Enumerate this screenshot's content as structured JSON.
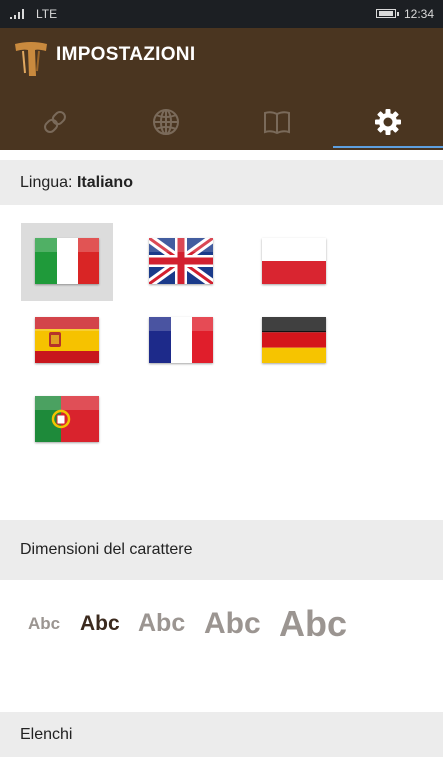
{
  "status": {
    "network": "LTE",
    "time": "12:34"
  },
  "header": {
    "title": "IMPOSTAZIONI",
    "logo_icon": "tau-cross-icon"
  },
  "tabs": [
    {
      "name": "link",
      "icon": "link-icon",
      "active": false
    },
    {
      "name": "web",
      "icon": "globe-icon",
      "active": false
    },
    {
      "name": "book",
      "icon": "book-icon",
      "active": false
    },
    {
      "name": "settings",
      "icon": "gear-icon",
      "active": true
    }
  ],
  "language": {
    "label": "Lingua:",
    "current": "Italiano",
    "flags": [
      {
        "name": "italy",
        "selected": true
      },
      {
        "name": "united-kingdom",
        "selected": false
      },
      {
        "name": "poland",
        "selected": false
      },
      {
        "name": "spain",
        "selected": false
      },
      {
        "name": "france",
        "selected": false
      },
      {
        "name": "germany",
        "selected": false
      },
      {
        "name": "portugal",
        "selected": false
      }
    ]
  },
  "font_size": {
    "label": "Dimensioni del carattere",
    "samples": [
      "Abc",
      "Abc",
      "Abc",
      "Abc",
      "Abc"
    ],
    "selected_index": 1
  },
  "next_section": {
    "label": "Elenchi"
  },
  "colors": {
    "appbar": "#4a3520",
    "selected_text": "#3b2a1e",
    "unselected_text": "#9b9591",
    "accent": "#5ea0e0"
  }
}
